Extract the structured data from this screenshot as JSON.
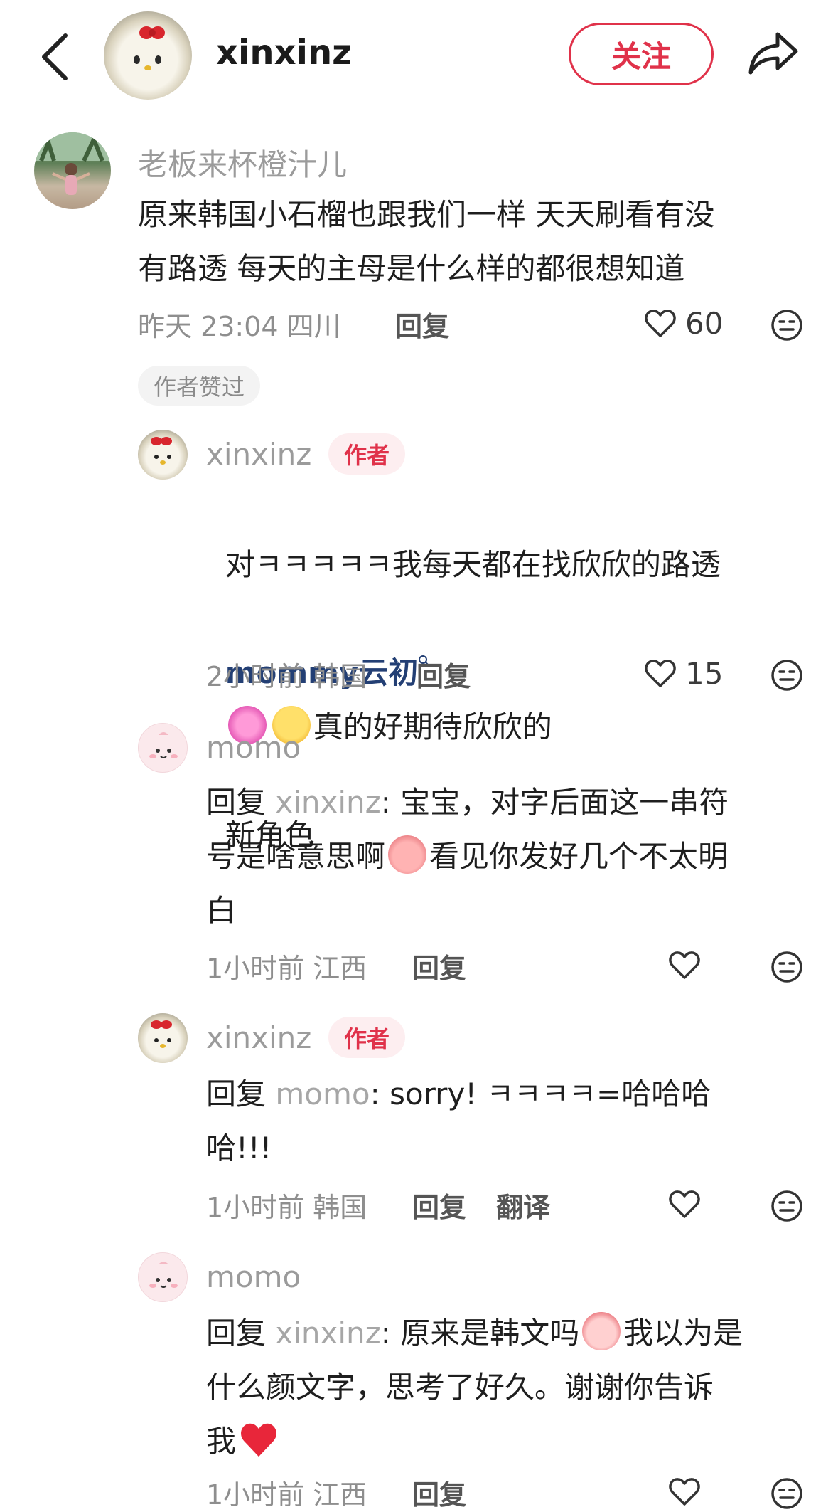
{
  "header": {
    "username": "xinxinz",
    "follow_label": "关注"
  },
  "top_comment": {
    "name": "老板来杯橙汁儿",
    "text": "原来韩国小石榴也跟我们一样 天天刷看有没\n有路透 每天的主母是什么样的都很想知道",
    "meta": "昨天 23:04 四川",
    "reply_label": "回复",
    "likes": "60",
    "liked_tag": "作者赞过"
  },
  "replies": [
    {
      "name": "xinxinz",
      "badge": "作者",
      "text_a": "对ㅋㅋㅋㅋㅋ我每天都在找欣欣的路透",
      "mention": "mommy云初",
      "text_b": "真的好期待欣欣的",
      "text_c": "新角色",
      "meta": "2小时前 韩国",
      "reply_label": "回复",
      "likes": "15"
    },
    {
      "name": "momo",
      "reply_prefix": "回复 ",
      "reply_to": "xinxinz",
      "text_a": ": 宝宝，对字后面这一串符",
      "text_b": "号是啥意思啊",
      "text_c": "看见你发好几个不太明",
      "text_d": "白",
      "meta": "1小时前 江西",
      "reply_label": "回复"
    },
    {
      "name": "xinxinz",
      "badge": "作者",
      "reply_prefix": "回复 ",
      "reply_to": "momo",
      "text_a": ": sorry! ㅋㅋㅋㅋ=哈哈哈",
      "text_b": "哈!!!",
      "meta": "1小时前 韩国",
      "reply_label": "回复",
      "translate_label": "翻译"
    },
    {
      "name": "momo",
      "reply_prefix": "回复 ",
      "reply_to": "xinxinz",
      "text_a": ": 原来是韩文吗",
      "text_b": "我以为是",
      "text_c": "什么颜文字，思考了好久。谢谢你告诉",
      "text_d": "我",
      "meta": "1小时前 江西",
      "reply_label": "回复"
    }
  ]
}
